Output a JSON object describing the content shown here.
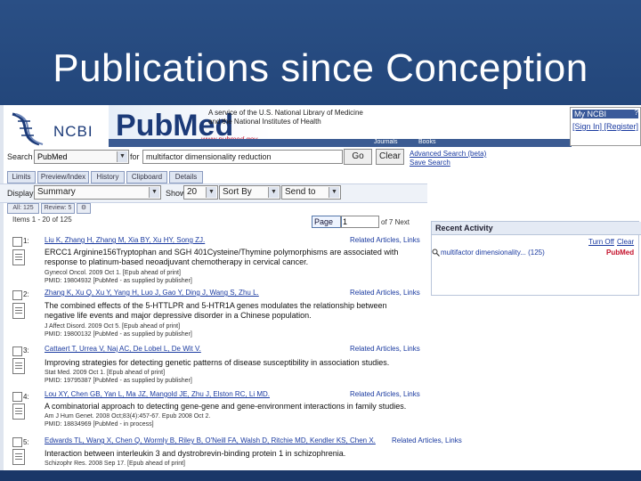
{
  "slide": {
    "title": "Publications since Conception"
  },
  "header": {
    "ncbi": "NCBI",
    "pubmed_pub": "Pub",
    "pubmed_med": "Med",
    "pubmed_url": "www.pubmed.gov",
    "nlm_line1": "A service of the U.S. National Library of Medicine",
    "nlm_line2": "and the National Institutes of Health",
    "myncbi_title": "My NCBI",
    "myncbi_close": "?",
    "myncbi_links": "[Sign In] [Register]",
    "nav": [
      "Journals",
      "Books"
    ]
  },
  "search": {
    "label": "Search",
    "db": "PubMed",
    "for_label": "for",
    "query": "multifactor dimensionality reduction",
    "go": "Go",
    "clear": "Clear",
    "advanced": "Advanced Search (beta)",
    "save": "Save Search"
  },
  "tabs": [
    "Limits",
    "Preview/Index",
    "History",
    "Clipboard",
    "Details"
  ],
  "display": {
    "label": "Display",
    "format": "Summary",
    "show_label": "Show",
    "count": "20",
    "sort": "Sort By",
    "send": "Send to"
  },
  "subtabs": [
    "All: 125",
    "Review: 5"
  ],
  "items": {
    "text": "Items 1 - 20 of 125",
    "page_label": "Page",
    "page_value": "1",
    "page_of": "of 7 Next"
  },
  "results": [
    {
      "num": "1:",
      "authors": "Liu K, Zhang H, Zhang M, Xia BY, Xu HY, Song ZJ.",
      "related": "Related Articles, Links",
      "title": "ERCC1 Arginine156Tryptophan and SGH 401Cysteine/Thymine polymorphisms are associated with response to platinum-based neoadjuvant chemotherapy in cervical cancer.",
      "meta1": "Gynecol Oncol. 2009 Oct 1. [Epub ahead of print]",
      "meta2": "PMID: 19804932 [PubMed - as supplied by publisher]"
    },
    {
      "num": "2:",
      "authors": "Zhang K, Xu Q, Xu Y, Yang H, Luo J, Gao Y, Ding J, Wang S, Zhu L.",
      "related": "Related Articles, Links",
      "title": "The combined effects of the 5-HTTLPR and 5-HTR1A genes modulates the relationship between negative life events and major depressive disorder in a Chinese population.",
      "meta1": "J Affect Disord. 2009 Oct 5. [Epub ahead of print]",
      "meta2": "PMID: 19800132 [PubMed - as supplied by publisher]"
    },
    {
      "num": "3:",
      "authors": "Cattaert T, Urrea V, Naj AC, De Lobel L, De Wit V.",
      "related": "Related Articles, Links",
      "title": "Improving strategies for detecting genetic patterns of disease susceptibility in association studies.",
      "meta1": "Stat Med. 2009 Oct 1. [Epub ahead of print]",
      "meta2": "PMID: 19795387 [PubMed - as supplied by publisher]"
    },
    {
      "num": "4:",
      "authors": "Lou XY, Chen GB, Yan L, Ma JZ, Mangold JE, Zhu J, Elston RC, Li MD.",
      "related": "Related Articles, Links",
      "title": "A combinatorial approach to detecting gene-gene and gene-environment interactions in family studies.",
      "meta1": "Am J Hum Genet. 2008 Oct;83(4):457-67. Epub 2008 Oct 2.",
      "meta2": "PMID: 18834969 [PubMed - in process]"
    },
    {
      "num": "5:",
      "authors": "Edwards TL, Wang X, Chen Q, Wormly B, Riley B, O'Neill FA, Walsh D, Ritchie MD, Kendler KS, Chen X.",
      "related": "Related Articles, Links",
      "title": "Interaction between interleukin 3 and dystrobrevin-binding protein 1 in schizophrenia.",
      "meta1": "Schizophr Res. 2008 Sep 17. [Epub ahead of print]",
      "meta2": ""
    }
  ],
  "recent": {
    "title": "Recent Activity",
    "turn_off": "Turn Off",
    "clear": "Clear",
    "item": "multifactor dimensionality... (125)",
    "db": "PubMed"
  }
}
